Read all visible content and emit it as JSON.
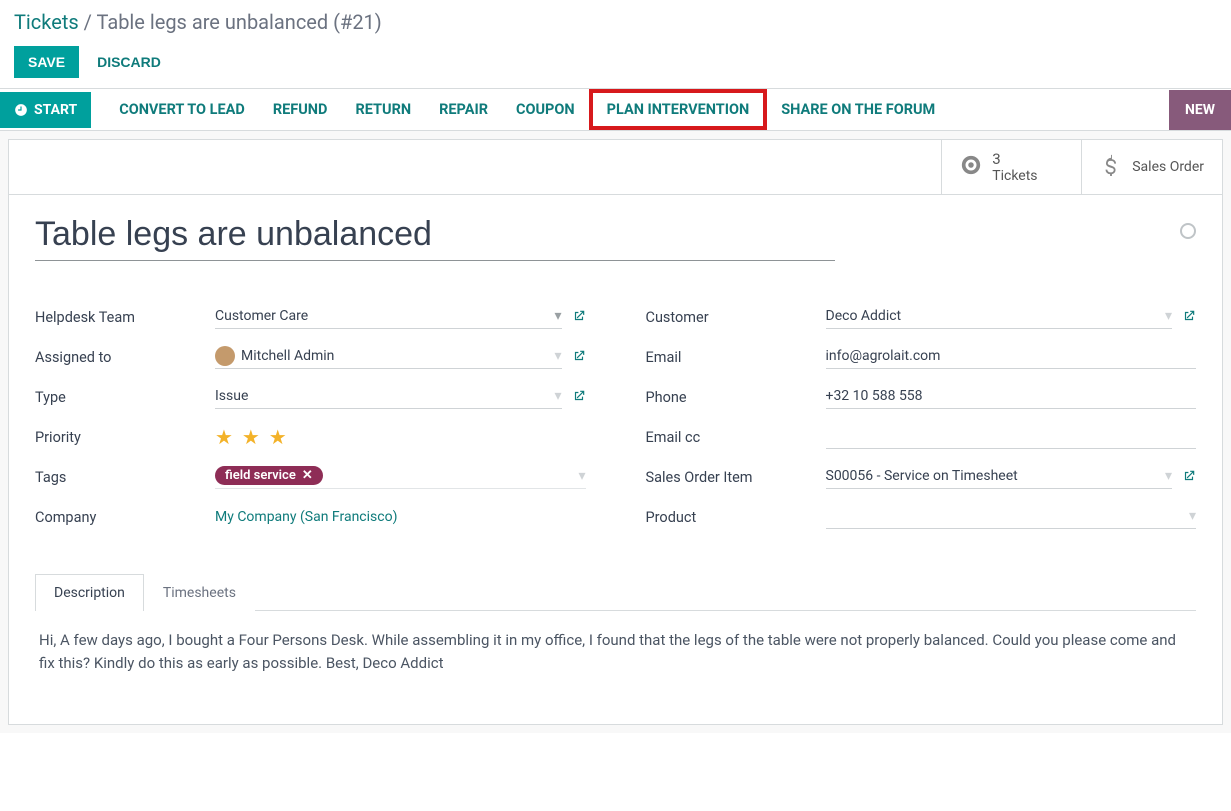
{
  "breadcrumb": {
    "root": "Tickets",
    "sep": "/",
    "title": "Table legs are unbalanced (#21)"
  },
  "buttons": {
    "save": "SAVE",
    "discard": "DISCARD"
  },
  "actions": {
    "start": "START",
    "convert": "CONVERT TO LEAD",
    "refund": "REFUND",
    "return": "RETURN",
    "repair": "REPAIR",
    "coupon": "COUPON",
    "plan": "PLAN INTERVENTION",
    "share": "SHARE ON THE FORUM",
    "new": "NEW"
  },
  "stats": {
    "tickets_count": "3",
    "tickets_label": "Tickets",
    "sales_order": "Sales Order"
  },
  "record": {
    "title": "Table legs are unbalanced"
  },
  "left": {
    "helpdesk_team": {
      "label": "Helpdesk Team",
      "value": "Customer Care"
    },
    "assigned_to": {
      "label": "Assigned to",
      "value": "Mitchell Admin"
    },
    "type": {
      "label": "Type",
      "value": "Issue"
    },
    "priority": {
      "label": "Priority"
    },
    "tags": {
      "label": "Tags",
      "value": "field service"
    },
    "company": {
      "label": "Company",
      "value": "My Company (San Francisco)"
    }
  },
  "right": {
    "customer": {
      "label": "Customer",
      "value": "Deco Addict"
    },
    "email": {
      "label": "Email",
      "value": "info@agrolait.com"
    },
    "phone": {
      "label": "Phone",
      "value": "+32 10 588 558"
    },
    "email_cc": {
      "label": "Email cc",
      "value": ""
    },
    "so_item": {
      "label": "Sales Order Item",
      "value": "S00056 - Service on Timesheet"
    },
    "product": {
      "label": "Product",
      "value": ""
    }
  },
  "tabs": {
    "description": "Description",
    "timesheets": "Timesheets"
  },
  "description_body": "Hi, A few days ago, I bought a Four Persons Desk. While assembling it in my office, I found that the legs of the table were not properly balanced. Could you please come and fix this? Kindly do this as early as possible. Best, Deco Addict"
}
